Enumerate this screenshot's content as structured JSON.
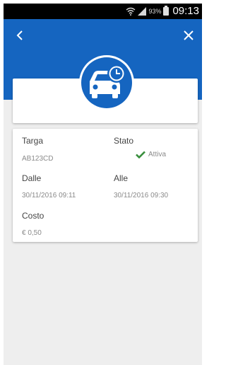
{
  "status_bar": {
    "battery_percent": "93%",
    "time": "09:13"
  },
  "header": {
    "icons": {
      "back": "chevron-left-icon",
      "close": "close-icon",
      "badge": "car-clock-icon"
    },
    "accent_color": "#1565c0"
  },
  "details": {
    "plate_label": "Targa",
    "plate_value": "AB123CD",
    "state_label": "Stato",
    "state_value": "Attiva",
    "state_color": "#388e3c",
    "from_label": "Dalle",
    "from_value": "30/11/2016 09:11",
    "to_label": "Alle",
    "to_value": "30/11/2016 09:30",
    "cost_label": "Costo",
    "cost_value": "€ 0,50"
  }
}
